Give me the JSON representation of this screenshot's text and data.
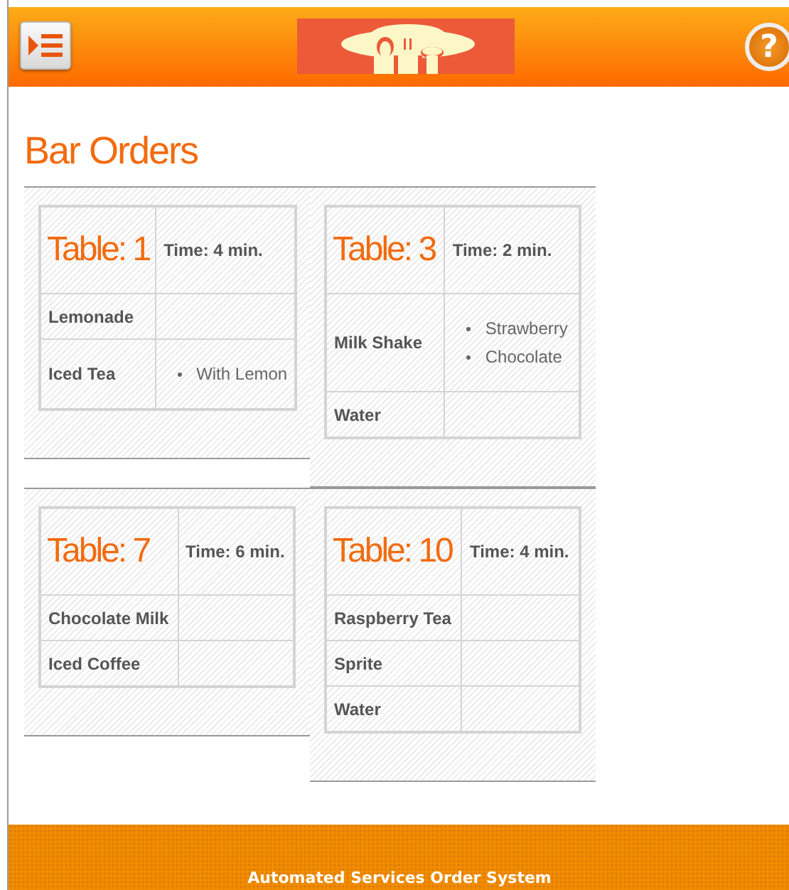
{
  "header": {
    "help_button": "?"
  },
  "page": {
    "title": "Bar Orders"
  },
  "tables": [
    {
      "label": "Table: 1",
      "time": "Time: 4 min.",
      "items": [
        {
          "name": "Lemonade"
        },
        {
          "name": "Iced Tea",
          "notes": [
            "With Lemon"
          ]
        }
      ]
    },
    {
      "label": "Table: 3",
      "time": "Time: 2 min.",
      "items": [
        {
          "name": "Milk Shake",
          "notes": [
            "Strawberry",
            "Chocolate"
          ]
        },
        {
          "name": "Water"
        }
      ]
    },
    {
      "label": "Table: 7",
      "time": "Time: 6 min.",
      "items": [
        {
          "name": "Chocolate Milk"
        },
        {
          "name": "Iced Coffee"
        }
      ]
    },
    {
      "label": "Table: 10",
      "time": "Time: 4 min.",
      "items": [
        {
          "name": "Raspberry Tea"
        },
        {
          "name": "Sprite"
        },
        {
          "name": "Water"
        }
      ]
    }
  ],
  "footer": {
    "text": "Automated Services Order System"
  }
}
